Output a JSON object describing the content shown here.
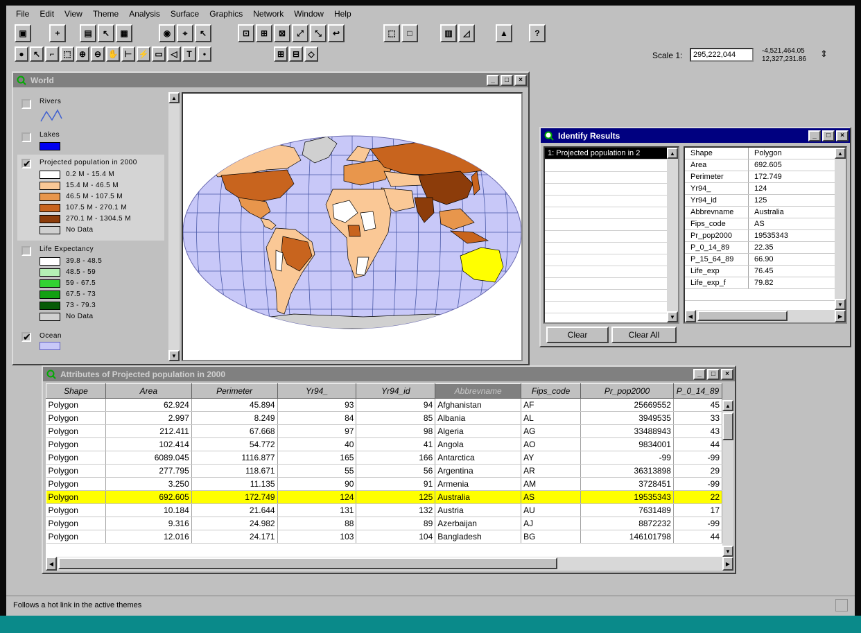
{
  "menu": [
    "File",
    "Edit",
    "View",
    "Theme",
    "Analysis",
    "Surface",
    "Graphics",
    "Network",
    "Window",
    "Help"
  ],
  "scale": {
    "label": "Scale 1:",
    "value": "295,222,044"
  },
  "coords": {
    "x": "-4,521,464.05",
    "y": "12,327,231.86"
  },
  "world": {
    "title": "World",
    "legend": {
      "rivers": {
        "name": "Rivers",
        "checked": false
      },
      "lakes": {
        "name": "Lakes",
        "checked": false,
        "color": "#0000f0"
      },
      "population": {
        "name": "Projected population in 2000",
        "checked": true,
        "classes": [
          {
            "label": "0.2 M - 15.4 M",
            "color": "#ffffff"
          },
          {
            "label": "15.4 M - 46.5 M",
            "color": "#fac896"
          },
          {
            "label": "46.5 M - 107.5 M",
            "color": "#e8964c"
          },
          {
            "label": "107.5 M - 270.1 M",
            "color": "#c8641e"
          },
          {
            "label": "270.1 M - 1304.5 M",
            "color": "#8c3c0a"
          },
          {
            "label": "No Data",
            "color": "#d0d0d0"
          }
        ]
      },
      "life": {
        "name": "Life Expectancy",
        "checked": false,
        "classes": [
          {
            "label": "39.8 - 48.5",
            "color": "#ffffff"
          },
          {
            "label": "48.5 - 59",
            "color": "#b4f0b4"
          },
          {
            "label": "59 - 67.5",
            "color": "#32d232"
          },
          {
            "label": "67.5 - 73",
            "color": "#12a012"
          },
          {
            "label": "73 - 79.3",
            "color": "#065a06"
          },
          {
            "label": "No Data",
            "color": "#d0d0d0"
          }
        ]
      },
      "ocean": {
        "name": "Ocean",
        "checked": true,
        "color": "#c8c8f8"
      }
    }
  },
  "identify": {
    "title": "Identify Results",
    "list": [
      "1: Projected population in 2"
    ],
    "fields": [
      [
        "Shape",
        "Polygon"
      ],
      [
        "Area",
        "692.605"
      ],
      [
        "Perimeter",
        "172.749"
      ],
      [
        "Yr94_",
        "124"
      ],
      [
        "Yr94_id",
        "125"
      ],
      [
        "Abbrevname",
        "Australia"
      ],
      [
        "Fips_code",
        "AS"
      ],
      [
        "Pr_pop2000",
        "19535343"
      ],
      [
        "P_0_14_89",
        "22.35"
      ],
      [
        "P_15_64_89",
        "66.90"
      ],
      [
        "Life_exp",
        "76.45"
      ],
      [
        "Life_exp_f",
        "79.82"
      ]
    ],
    "clear_label": "Clear",
    "clear_all_label": "Clear All"
  },
  "attributes": {
    "title": "Attributes of Projected population in 2000",
    "columns": [
      "Shape",
      "Area",
      "Perimeter",
      "Yr94_",
      "Yr94_id",
      "Abbrevname",
      "Fips_code",
      "Pr_pop2000",
      "P_0_14_89"
    ],
    "rows": [
      [
        "Polygon",
        "62.924",
        "45.894",
        "93",
        "94",
        "Afghanistan",
        "AF",
        "25669552",
        "45"
      ],
      [
        "Polygon",
        "2.997",
        "8.249",
        "84",
        "85",
        "Albania",
        "AL",
        "3949535",
        "33"
      ],
      [
        "Polygon",
        "212.411",
        "67.668",
        "97",
        "98",
        "Algeria",
        "AG",
        "33488943",
        "43"
      ],
      [
        "Polygon",
        "102.414",
        "54.772",
        "40",
        "41",
        "Angola",
        "AO",
        "9834001",
        "44"
      ],
      [
        "Polygon",
        "6089.045",
        "1116.877",
        "165",
        "166",
        "Antarctica",
        "AY",
        "-99",
        "-99"
      ],
      [
        "Polygon",
        "277.795",
        "118.671",
        "55",
        "56",
        "Argentina",
        "AR",
        "36313898",
        "29"
      ],
      [
        "Polygon",
        "3.250",
        "11.135",
        "90",
        "91",
        "Armenia",
        "AM",
        "3728451",
        "-99"
      ],
      [
        "Polygon",
        "692.605",
        "172.749",
        "124",
        "125",
        "Australia",
        "AS",
        "19535343",
        "22"
      ],
      [
        "Polygon",
        "10.184",
        "21.644",
        "131",
        "132",
        "Austria",
        "AU",
        "7631489",
        "17"
      ],
      [
        "Polygon",
        "9.316",
        "24.982",
        "88",
        "89",
        "Azerbaijan",
        "AJ",
        "8872232",
        "-99"
      ],
      [
        "Polygon",
        "12.016",
        "24.171",
        "103",
        "104",
        "Bangladesh",
        "BG",
        "146101798",
        "44"
      ]
    ],
    "highlight_color": "#ffff00"
  },
  "status": "Follows a hot link in the active themes"
}
